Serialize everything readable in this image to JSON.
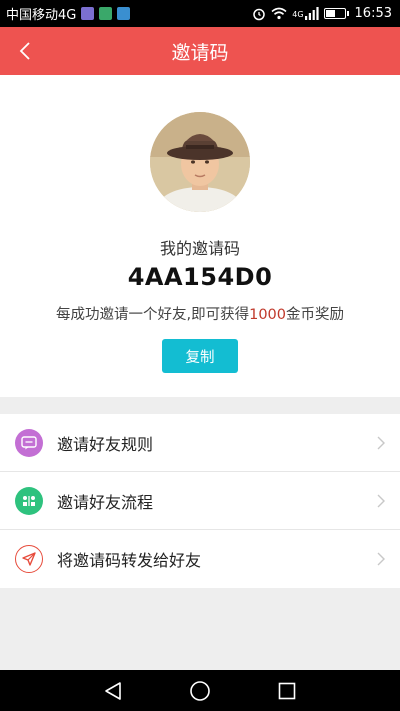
{
  "status_bar": {
    "carrier": "中国移动4G",
    "network_label": "4G",
    "time": "16:53",
    "icons": [
      "app-notification-icon",
      "alarm-icon",
      "wifi-icon",
      "signal-icon",
      "battery-icon"
    ]
  },
  "header": {
    "title": "邀请码",
    "back_icon": "chevron-left-icon",
    "color": "#ee5350"
  },
  "invite": {
    "label": "我的邀请码",
    "code": "4AA154D0",
    "reward_prefix": "每成功邀请一个好友,即可获得",
    "reward_amount": "1000",
    "reward_suffix": "金币奖励",
    "copy_label": "复制",
    "copy_color": "#13bdd2"
  },
  "menu": {
    "items": [
      {
        "label": "邀请好友规则",
        "icon": "chat-bubble-icon",
        "color": "#c36fd4"
      },
      {
        "label": "邀请好友流程",
        "icon": "flow-icon",
        "color": "#2ec27e"
      },
      {
        "label": "将邀请码转发给好友",
        "icon": "paper-plane-icon",
        "color": "#e74c3c"
      }
    ]
  }
}
